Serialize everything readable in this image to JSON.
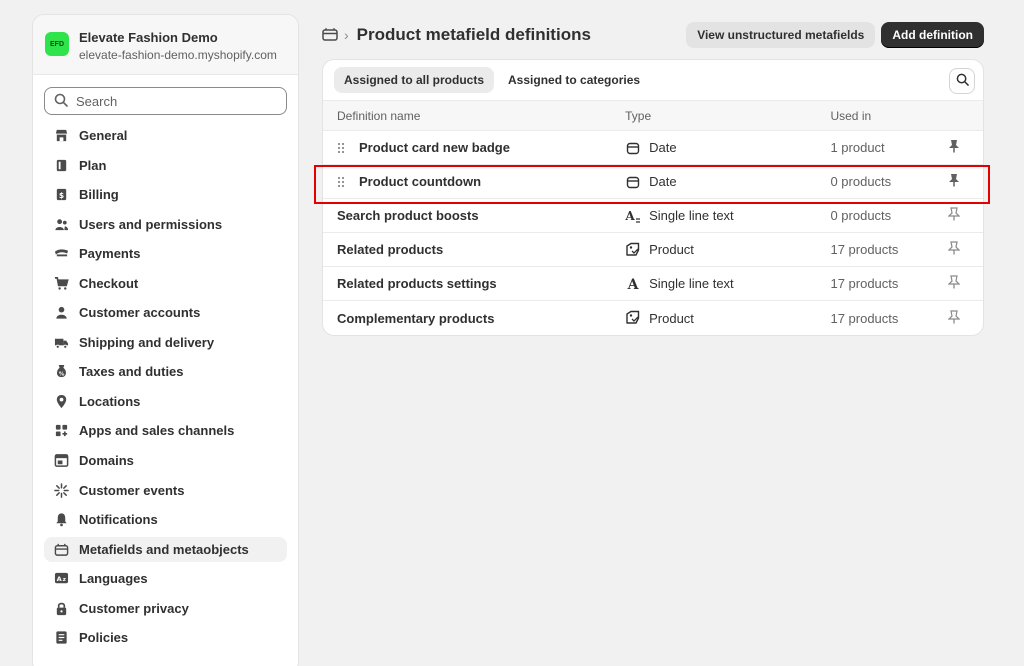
{
  "store": {
    "avatar_initials": "EFD",
    "name": "Elevate Fashion Demo",
    "domain": "elevate-fashion-demo.myshopify.com"
  },
  "sidebar": {
    "search_placeholder": "Search",
    "items": [
      {
        "label": "General",
        "icon": "store-icon"
      },
      {
        "label": "Plan",
        "icon": "plan-icon"
      },
      {
        "label": "Billing",
        "icon": "billing-icon"
      },
      {
        "label": "Users and permissions",
        "icon": "users-icon"
      },
      {
        "label": "Payments",
        "icon": "payments-icon"
      },
      {
        "label": "Checkout",
        "icon": "cart-icon"
      },
      {
        "label": "Customer accounts",
        "icon": "person-icon"
      },
      {
        "label": "Shipping and delivery",
        "icon": "truck-icon"
      },
      {
        "label": "Taxes and duties",
        "icon": "tax-icon"
      },
      {
        "label": "Locations",
        "icon": "location-icon"
      },
      {
        "label": "Apps and sales channels",
        "icon": "apps-icon"
      },
      {
        "label": "Domains",
        "icon": "domains-icon"
      },
      {
        "label": "Customer events",
        "icon": "events-icon"
      },
      {
        "label": "Notifications",
        "icon": "bell-icon"
      },
      {
        "label": "Metafields and metaobjects",
        "icon": "metafields-icon",
        "active": true
      },
      {
        "label": "Languages",
        "icon": "language-icon"
      },
      {
        "label": "Customer privacy",
        "icon": "lock-icon"
      },
      {
        "label": "Policies",
        "icon": "policies-icon"
      }
    ]
  },
  "header": {
    "title": "Product metafield definitions",
    "secondary_button": "View unstructured metafields",
    "primary_button": "Add definition"
  },
  "tabs": [
    {
      "label": "Assigned to all products",
      "selected": true
    },
    {
      "label": "Assigned to categories",
      "selected": false
    }
  ],
  "table": {
    "columns": [
      "Definition name",
      "Type",
      "Used in"
    ],
    "rows": [
      {
        "name": "Product card new badge",
        "type": "Date",
        "type_icon": "calendar-icon",
        "used": "1 product",
        "pinned": true
      },
      {
        "name": "Product countdown",
        "type": "Date",
        "type_icon": "calendar-icon",
        "used": "0 products",
        "pinned": true
      },
      {
        "name": "Search product boosts",
        "type": "Single line text",
        "type_icon": "text-list-icon",
        "used": "0 products",
        "pinned": false
      },
      {
        "name": "Related products",
        "type": "Product",
        "type_icon": "product-tag-icon",
        "used": "17 products",
        "pinned": false
      },
      {
        "name": "Related products settings",
        "type": "Single line text",
        "type_icon": "text-icon",
        "used": "17 products",
        "pinned": false
      },
      {
        "name": "Complementary products",
        "type": "Product",
        "type_icon": "product-tag-icon",
        "used": "17 products",
        "pinned": false
      }
    ]
  },
  "colors": {
    "avatar": "#2ee44a",
    "primary_button": "#303030",
    "highlight": "#e50000"
  }
}
